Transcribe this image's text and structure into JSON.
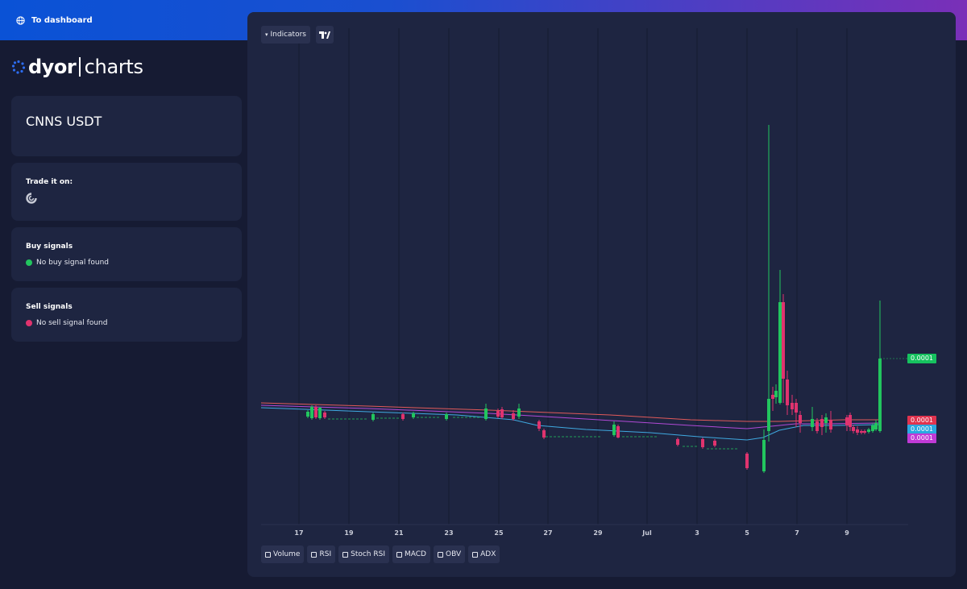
{
  "topbar": {
    "back_label": "To dashboard"
  },
  "logo": {
    "primary": "dyor",
    "secondary": "charts"
  },
  "pair": {
    "name": "CNNS USDT"
  },
  "trade": {
    "heading": "Trade it on:",
    "exchange_icon": "exchange-logo-icon"
  },
  "buy_signals": {
    "heading": "Buy signals",
    "text": "No buy signal found",
    "color": "#22c55e"
  },
  "sell_signals": {
    "heading": "Sell signals",
    "text": "No sell signal found",
    "color": "#e0336e"
  },
  "toolbar": {
    "indicators_label": "Indicators",
    "tv_icon": "tradingview-icon"
  },
  "indicator_toggles": [
    "Volume",
    "RSI",
    "Stoch RSI",
    "MACD",
    "OBV",
    "ADX"
  ],
  "colors": {
    "up": "#22c55e",
    "down": "#e0336e",
    "ema_red": "#e25a5a",
    "ema_purple": "#b14ad6",
    "ema_blue": "#3fa9e0",
    "grid": "#141a30"
  },
  "price_labels": [
    {
      "text": "0.0001",
      "color": "#16c25f"
    },
    {
      "text": "0.0001",
      "color": "#e0334e"
    },
    {
      "text": "0.0001",
      "color": "#2aa9e0"
    },
    {
      "text": "0.0001",
      "color": "#c03ad6"
    }
  ],
  "chart_data": {
    "type": "candlestick",
    "x_tick_labels": [
      "17",
      "19",
      "21",
      "23",
      "25",
      "27",
      "29",
      "Jul",
      "3",
      "5",
      "7",
      "9"
    ],
    "series": [
      {
        "type": "candles"
      },
      {
        "type": "moving-average"
      },
      {
        "type": "moving-average"
      },
      {
        "type": "moving-average"
      }
    ],
    "last_price_label": "0.0001",
    "grid": true
  }
}
